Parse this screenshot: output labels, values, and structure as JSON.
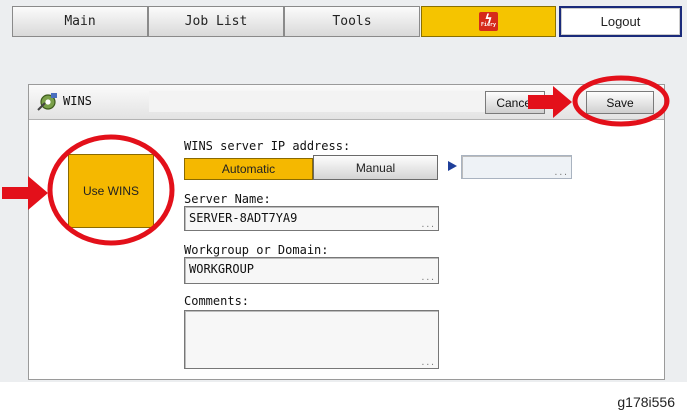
{
  "tabs": {
    "main": "Main",
    "job_list": "Job List",
    "tools": "Tools",
    "fiery_icon": "fiery-logo-icon",
    "logout": "Logout"
  },
  "dialog": {
    "title": "WINS",
    "cancel_label": "Cancel",
    "save_label": "Save"
  },
  "form": {
    "use_wins_label": "Use WINS",
    "ip_label": "WINS server IP address:",
    "automatic_label": "Automatic",
    "manual_label": "Manual",
    "ip_value": "",
    "server_name_label": "Server Name:",
    "server_name_value": "SERVER-8ADT7YA9",
    "workgroup_label": "Workgroup or Domain:",
    "workgroup_value": "WORKGROUP",
    "comments_label": "Comments:",
    "comments_value": ""
  },
  "colors": {
    "selected": "#f5b800",
    "annotation": "#e3101a",
    "accent_arrow": "#1f3f9a"
  },
  "footer_code": "g178i556"
}
